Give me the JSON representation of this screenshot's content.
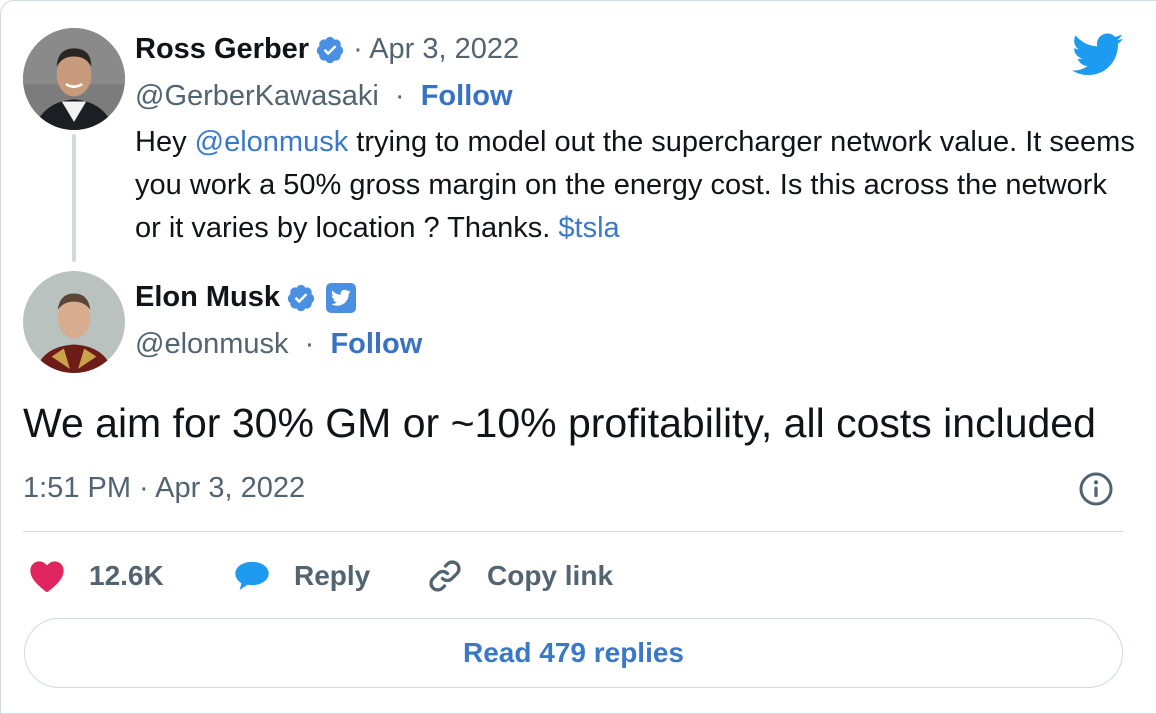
{
  "parent_tweet": {
    "author_name": "Ross Gerber",
    "date": "· Apr 3, 2022",
    "handle": "@GerberKawasaki",
    "separator": "·",
    "follow_label": "Follow",
    "text_before_mention": "Hey ",
    "mention": "@elonmusk",
    "text_after_mention": " trying to model out the supercharger network value. It seems you work a 50% gross margin on the energy cost. Is this across the network or it varies by location ? Thanks. ",
    "cashtag": "$tsla"
  },
  "main_tweet": {
    "author_name": "Elon Musk",
    "handle": "@elonmusk",
    "separator": "·",
    "follow_label": "Follow",
    "text": "We aim for 30% GM or ~10% profitability, all costs included",
    "timestamp": "1:51 PM · Apr 3, 2022"
  },
  "actions": {
    "like_count": "12.6K",
    "reply_label": "Reply",
    "copy_link_label": "Copy link"
  },
  "read_replies_label": "Read 479 replies",
  "icons": {
    "verified": "verified-badge-icon",
    "affiliate": "twitter-affiliate-badge-icon",
    "logo": "twitter-bird-icon",
    "info": "info-icon",
    "like": "heart-icon",
    "reply": "speech-bubble-icon",
    "copy": "link-icon"
  },
  "colors": {
    "link_blue": "#3a78c8",
    "follow_blue": "#3872c5",
    "twitter_blue": "#1d9bf0",
    "verified_blue": "#4a90e2",
    "heart_pink": "#e0245e",
    "secondary_text": "#536471",
    "border": "#cfd9de"
  }
}
